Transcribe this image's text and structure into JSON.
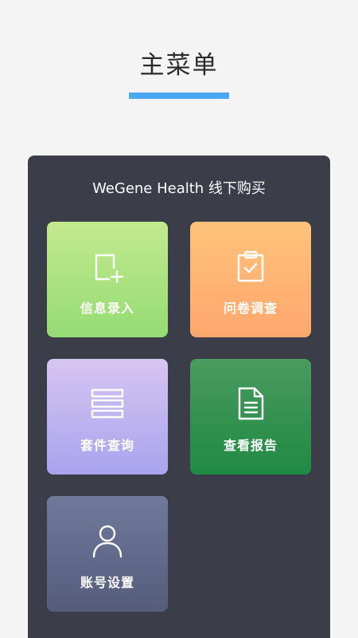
{
  "header": {
    "title": "主菜单",
    "accent_color": "#4aa9f0"
  },
  "panel": {
    "title": "WeGene Health 线下购买",
    "background_color": "#3b3e48"
  },
  "menu": [
    {
      "id": "info-entry",
      "label": "信息录入",
      "icon": "add-document-icon"
    },
    {
      "id": "questionnaire",
      "label": "问卷调查",
      "icon": "clipboard-check-icon"
    },
    {
      "id": "kit-query",
      "label": "套件查询",
      "icon": "stacked-list-icon"
    },
    {
      "id": "view-report",
      "label": "查看报告",
      "icon": "document-icon"
    },
    {
      "id": "account-settings",
      "label": "账号设置",
      "icon": "user-icon"
    }
  ]
}
